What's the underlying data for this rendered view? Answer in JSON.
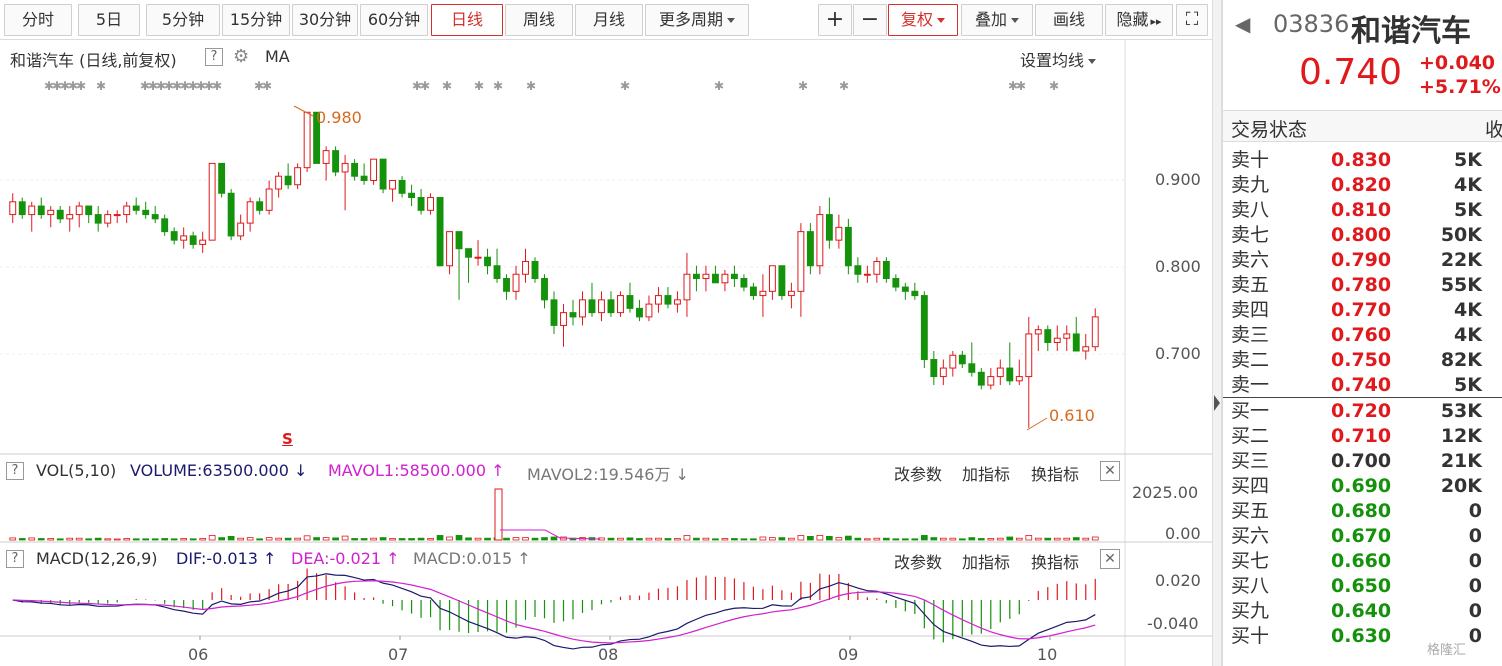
{
  "toolbar": {
    "tabs": [
      "分时",
      "5日",
      "5分钟",
      "15分钟",
      "30分钟",
      "60分钟",
      "日线",
      "周线",
      "月线",
      "更多周期"
    ],
    "active_tab": "日线",
    "plus": "+",
    "minus": "−",
    "fuquan": "复权",
    "overlay": "叠加",
    "draw": "画线",
    "hide": "隐藏",
    "hide_arrows": "▸▸",
    "expand": "⛶"
  },
  "main": {
    "title": "和谐汽车 (日线,前复权)",
    "help": "?",
    "ma_label": "MA",
    "settings": "设置均线",
    "high_label": "0.980",
    "low_label": "0.610",
    "s_marker": "S",
    "y_ticks": [
      "0.900",
      "0.800",
      "0.700"
    ]
  },
  "volume": {
    "help": "?",
    "name": "VOL(5,10)",
    "volume": "VOLUME:63500.000",
    "mavol1": "MAVOL1:58500.000",
    "mavol2": "MAVOL2:19.546万",
    "change_params": "改参数",
    "add_indicator": "加指标",
    "switch_indicator": "换指标",
    "close": "✕",
    "y_ticks": [
      "2025.00",
      "0.00"
    ]
  },
  "macd": {
    "help": "?",
    "name": "MACD(12,26,9)",
    "dif": "DIF:-0.013",
    "dea": "DEA:-0.021",
    "macd": "MACD:0.015",
    "change_params": "改参数",
    "add_indicator": "加指标",
    "switch_indicator": "换指标",
    "close": "✕",
    "y_ticks": [
      "0.020",
      "-0.040"
    ]
  },
  "x_ticks": [
    "06",
    "07",
    "08",
    "09",
    "10"
  ],
  "stock": {
    "back": "◀",
    "code": "03836",
    "name": "和谐汽车",
    "price": "0.740",
    "change": "+0.040",
    "change_pct": "+5.71%",
    "status_label": "交易状态",
    "status_more": "收"
  },
  "orderbook": {
    "asks": [
      {
        "n": "卖十",
        "p": "0.830",
        "v": "5K"
      },
      {
        "n": "卖九",
        "p": "0.820",
        "v": "4K"
      },
      {
        "n": "卖八",
        "p": "0.810",
        "v": "5K"
      },
      {
        "n": "卖七",
        "p": "0.800",
        "v": "50K"
      },
      {
        "n": "卖六",
        "p": "0.790",
        "v": "22K"
      },
      {
        "n": "卖五",
        "p": "0.780",
        "v": "55K"
      },
      {
        "n": "卖四",
        "p": "0.770",
        "v": "4K"
      },
      {
        "n": "卖三",
        "p": "0.760",
        "v": "4K"
      },
      {
        "n": "卖二",
        "p": "0.750",
        "v": "82K"
      },
      {
        "n": "卖一",
        "p": "0.740",
        "v": "5K"
      }
    ],
    "bids": [
      {
        "n": "买一",
        "p": "0.720",
        "v": "53K"
      },
      {
        "n": "买二",
        "p": "0.710",
        "v": "12K"
      },
      {
        "n": "买三",
        "p": "0.700",
        "v": "21K"
      },
      {
        "n": "买四",
        "p": "0.690",
        "v": "20K"
      },
      {
        "n": "买五",
        "p": "0.680",
        "v": "0"
      },
      {
        "n": "买六",
        "p": "0.670",
        "v": "0"
      },
      {
        "n": "买七",
        "p": "0.660",
        "v": "0"
      },
      {
        "n": "买八",
        "p": "0.650",
        "v": "0"
      },
      {
        "n": "买九",
        "p": "0.640",
        "v": "0"
      },
      {
        "n": "买十",
        "p": "0.630",
        "v": "0"
      }
    ]
  },
  "watermark": "格隆汇",
  "colors": {
    "up": "#e0191c",
    "down": "#14920b",
    "accent": "#d6302a",
    "macd_dif": "#1a1a6e",
    "macd_dea": "#d020d0"
  },
  "chart_data": {
    "type": "candlestick",
    "ylim": [
      0.605,
      0.985
    ],
    "candles": [
      [
        0.86,
        0.885,
        0.85,
        0.875
      ],
      [
        0.875,
        0.88,
        0.855,
        0.86
      ],
      [
        0.86,
        0.875,
        0.84,
        0.87
      ],
      [
        0.87,
        0.88,
        0.855,
        0.86
      ],
      [
        0.86,
        0.87,
        0.845,
        0.865
      ],
      [
        0.865,
        0.87,
        0.85,
        0.855
      ],
      [
        0.855,
        0.87,
        0.84,
        0.86
      ],
      [
        0.86,
        0.875,
        0.845,
        0.87
      ],
      [
        0.87,
        0.87,
        0.85,
        0.86
      ],
      [
        0.86,
        0.87,
        0.84,
        0.85
      ],
      [
        0.85,
        0.865,
        0.845,
        0.86
      ],
      [
        0.86,
        0.865,
        0.85,
        0.86
      ],
      [
        0.86,
        0.875,
        0.85,
        0.87
      ],
      [
        0.87,
        0.88,
        0.86,
        0.865
      ],
      [
        0.865,
        0.875,
        0.855,
        0.86
      ],
      [
        0.86,
        0.87,
        0.85,
        0.855
      ],
      [
        0.855,
        0.86,
        0.835,
        0.84
      ],
      [
        0.84,
        0.845,
        0.825,
        0.83
      ],
      [
        0.83,
        0.845,
        0.82,
        0.835
      ],
      [
        0.835,
        0.84,
        0.82,
        0.825
      ],
      [
        0.825,
        0.84,
        0.815,
        0.83
      ],
      [
        0.83,
        0.92,
        0.83,
        0.92
      ],
      [
        0.92,
        0.92,
        0.88,
        0.885
      ],
      [
        0.885,
        0.89,
        0.83,
        0.835
      ],
      [
        0.835,
        0.86,
        0.83,
        0.85
      ],
      [
        0.85,
        0.88,
        0.84,
        0.875
      ],
      [
        0.875,
        0.88,
        0.86,
        0.865
      ],
      [
        0.865,
        0.9,
        0.86,
        0.89
      ],
      [
        0.89,
        0.91,
        0.88,
        0.905
      ],
      [
        0.905,
        0.92,
        0.89,
        0.895
      ],
      [
        0.895,
        0.92,
        0.89,
        0.915
      ],
      [
        0.915,
        0.98,
        0.91,
        0.98
      ],
      [
        0.98,
        0.96,
        0.92,
        0.92
      ],
      [
        0.92,
        0.94,
        0.9,
        0.935
      ],
      [
        0.935,
        0.94,
        0.905,
        0.91
      ],
      [
        0.91,
        0.93,
        0.865,
        0.92
      ],
      [
        0.92,
        0.925,
        0.9,
        0.905
      ],
      [
        0.905,
        0.92,
        0.895,
        0.9
      ],
      [
        0.9,
        0.925,
        0.895,
        0.925
      ],
      [
        0.925,
        0.925,
        0.885,
        0.89
      ],
      [
        0.89,
        0.9,
        0.875,
        0.9
      ],
      [
        0.9,
        0.905,
        0.88,
        0.885
      ],
      [
        0.885,
        0.895,
        0.87,
        0.88
      ],
      [
        0.88,
        0.89,
        0.86,
        0.865
      ],
      [
        0.865,
        0.885,
        0.86,
        0.88
      ],
      [
        0.88,
        0.88,
        0.8,
        0.8
      ],
      [
        0.8,
        0.84,
        0.79,
        0.84
      ],
      [
        0.84,
        0.84,
        0.76,
        0.82
      ],
      [
        0.82,
        0.815,
        0.78,
        0.81
      ],
      [
        0.81,
        0.83,
        0.8,
        0.81
      ],
      [
        0.81,
        0.82,
        0.79,
        0.8
      ],
      [
        0.8,
        0.82,
        0.78,
        0.785
      ],
      [
        0.785,
        0.79,
        0.76,
        0.77
      ],
      [
        0.77,
        0.8,
        0.76,
        0.79
      ],
      [
        0.79,
        0.82,
        0.78,
        0.805
      ],
      [
        0.805,
        0.81,
        0.78,
        0.785
      ],
      [
        0.785,
        0.79,
        0.75,
        0.76
      ],
      [
        0.76,
        0.77,
        0.72,
        0.73
      ],
      [
        0.73,
        0.755,
        0.705,
        0.745
      ],
      [
        0.745,
        0.76,
        0.73,
        0.74
      ],
      [
        0.74,
        0.77,
        0.73,
        0.76
      ],
      [
        0.76,
        0.78,
        0.74,
        0.745
      ],
      [
        0.745,
        0.77,
        0.735,
        0.76
      ],
      [
        0.76,
        0.77,
        0.74,
        0.745
      ],
      [
        0.745,
        0.77,
        0.74,
        0.765
      ],
      [
        0.765,
        0.78,
        0.745,
        0.75
      ],
      [
        0.75,
        0.76,
        0.735,
        0.74
      ],
      [
        0.74,
        0.765,
        0.735,
        0.755
      ],
      [
        0.755,
        0.775,
        0.745,
        0.765
      ],
      [
        0.765,
        0.775,
        0.75,
        0.755
      ],
      [
        0.755,
        0.77,
        0.745,
        0.76
      ],
      [
        0.76,
        0.815,
        0.74,
        0.79
      ],
      [
        0.79,
        0.8,
        0.77,
        0.785
      ],
      [
        0.785,
        0.8,
        0.77,
        0.79
      ],
      [
        0.79,
        0.8,
        0.78,
        0.78
      ],
      [
        0.78,
        0.795,
        0.77,
        0.79
      ],
      [
        0.79,
        0.8,
        0.775,
        0.785
      ],
      [
        0.785,
        0.79,
        0.77,
        0.775
      ],
      [
        0.775,
        0.78,
        0.76,
        0.765
      ],
      [
        0.765,
        0.79,
        0.74,
        0.77
      ],
      [
        0.77,
        0.8,
        0.76,
        0.8
      ],
      [
        0.8,
        0.8,
        0.76,
        0.765
      ],
      [
        0.765,
        0.78,
        0.75,
        0.77
      ],
      [
        0.77,
        0.85,
        0.74,
        0.84
      ],
      [
        0.84,
        0.85,
        0.79,
        0.8
      ],
      [
        0.8,
        0.87,
        0.79,
        0.86
      ],
      [
        0.86,
        0.88,
        0.82,
        0.83
      ],
      [
        0.83,
        0.86,
        0.82,
        0.845
      ],
      [
        0.845,
        0.855,
        0.79,
        0.8
      ],
      [
        0.8,
        0.81,
        0.78,
        0.79
      ],
      [
        0.79,
        0.8,
        0.78,
        0.79
      ],
      [
        0.79,
        0.81,
        0.78,
        0.805
      ],
      [
        0.805,
        0.81,
        0.78,
        0.785
      ],
      [
        0.785,
        0.79,
        0.77,
        0.775
      ],
      [
        0.775,
        0.78,
        0.76,
        0.77
      ],
      [
        0.77,
        0.78,
        0.76,
        0.765
      ],
      [
        0.765,
        0.77,
        0.68,
        0.69
      ],
      [
        0.69,
        0.7,
        0.66,
        0.67
      ],
      [
        0.67,
        0.69,
        0.66,
        0.68
      ],
      [
        0.68,
        0.7,
        0.67,
        0.695
      ],
      [
        0.695,
        0.7,
        0.68,
        0.685
      ],
      [
        0.685,
        0.71,
        0.67,
        0.675
      ],
      [
        0.675,
        0.68,
        0.655,
        0.66
      ],
      [
        0.66,
        0.68,
        0.655,
        0.67
      ],
      [
        0.67,
        0.69,
        0.66,
        0.68
      ],
      [
        0.68,
        0.71,
        0.66,
        0.665
      ],
      [
        0.665,
        0.69,
        0.66,
        0.67
      ],
      [
        0.67,
        0.74,
        0.61,
        0.72
      ],
      [
        0.72,
        0.73,
        0.7,
        0.725
      ],
      [
        0.725,
        0.73,
        0.7,
        0.71
      ],
      [
        0.71,
        0.73,
        0.7,
        0.715
      ],
      [
        0.715,
        0.73,
        0.7,
        0.72
      ],
      [
        0.72,
        0.74,
        0.7,
        0.7
      ],
      [
        0.7,
        0.72,
        0.69,
        0.705
      ],
      [
        0.705,
        0.75,
        0.7,
        0.74
      ]
    ]
  }
}
